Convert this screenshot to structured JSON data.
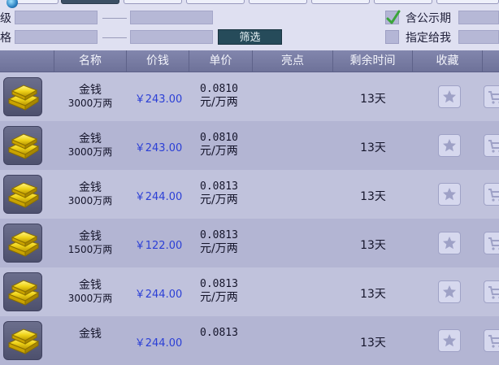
{
  "filters": {
    "label_row1": "级",
    "label_row2": "格",
    "filter_button": "筛选",
    "option_public": "含公示期",
    "option_assigned": "指定给我",
    "option_public_checked": true,
    "option_assigned_checked": false
  },
  "table": {
    "headers": [
      "名称",
      "价钱",
      "单价",
      "亮点",
      "剩余时间",
      "收藏"
    ],
    "rows": [
      {
        "icon": "gold-bars-icon",
        "name": "金钱",
        "amount": "3000万两",
        "price": "￥243.00",
        "unit_price": "0.0810",
        "unit_label": "元/万两",
        "highlight": "",
        "remaining": "13天"
      },
      {
        "icon": "gold-bars-icon",
        "name": "金钱",
        "amount": "3000万两",
        "price": "￥243.00",
        "unit_price": "0.0810",
        "unit_label": "元/万两",
        "highlight": "",
        "remaining": "13天"
      },
      {
        "icon": "gold-bars-icon",
        "name": "金钱",
        "amount": "3000万两",
        "price": "￥244.00",
        "unit_price": "0.0813",
        "unit_label": "元/万两",
        "highlight": "",
        "remaining": "13天"
      },
      {
        "icon": "gold-bars-icon",
        "name": "金钱",
        "amount": "1500万两",
        "price": "￥122.00",
        "unit_price": "0.0813",
        "unit_label": "元/万两",
        "highlight": "",
        "remaining": "13天"
      },
      {
        "icon": "gold-bars-icon",
        "name": "金钱",
        "amount": "3000万两",
        "price": "￥244.00",
        "unit_price": "0.0813",
        "unit_label": "元/万两",
        "highlight": "",
        "remaining": "13天"
      },
      {
        "icon": "gold-bars-icon",
        "name": "金钱",
        "amount": "",
        "price": "￥244.00",
        "unit_price": "0.0813",
        "unit_label": "",
        "highlight": "",
        "remaining": "13天"
      }
    ]
  },
  "colors": {
    "price_text": "#2b3fd6",
    "filter_button_bg": "#264b5a",
    "header_bg": "#7579a1"
  }
}
